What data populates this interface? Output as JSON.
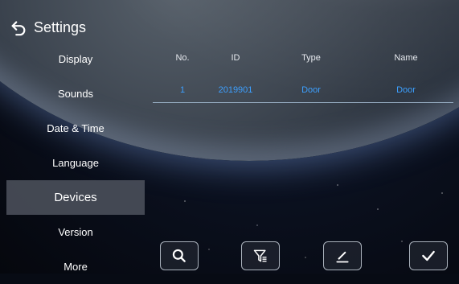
{
  "header": {
    "title": "Settings"
  },
  "sidebar": {
    "items": [
      {
        "label": "Display"
      },
      {
        "label": "Sounds"
      },
      {
        "label": "Date & Time"
      },
      {
        "label": "Language"
      },
      {
        "label": "Devices",
        "active": true
      },
      {
        "label": "Version"
      },
      {
        "label": "More"
      }
    ]
  },
  "table": {
    "columns": [
      "No.",
      "ID",
      "Type",
      "Name"
    ],
    "rows": [
      {
        "no": "1",
        "id": "2019901",
        "type": "Door",
        "name": "Door"
      }
    ]
  },
  "toolbar": {
    "buttons": [
      {
        "icon": "search-icon"
      },
      {
        "icon": "filter-icon"
      },
      {
        "icon": "edit-icon"
      },
      {
        "icon": "check-icon"
      }
    ]
  },
  "colors": {
    "accent": "#3da0ff",
    "active_bg": "#50565f"
  }
}
